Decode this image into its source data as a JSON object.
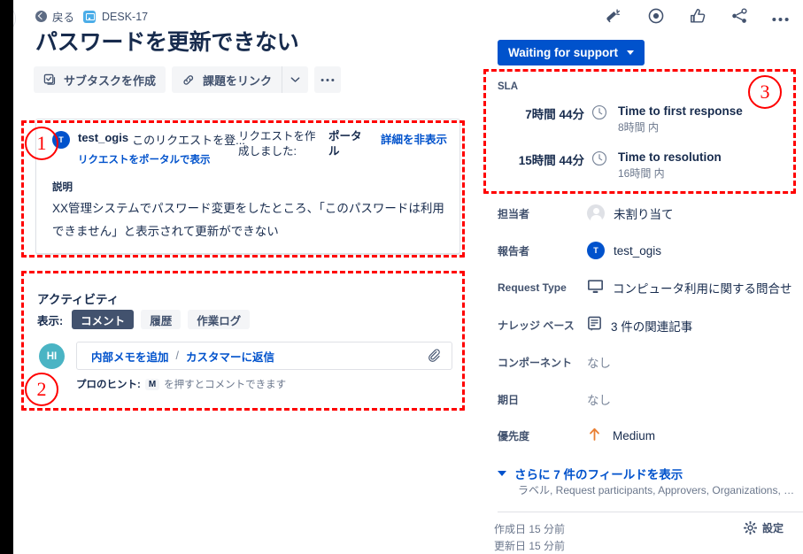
{
  "breadcrumb": {
    "back_label": "戻る",
    "issue_key": "DESK-17"
  },
  "page_title": "パスワードを更新できない",
  "toolbar": {
    "create_subtask": "サブタスクを作成",
    "link_issue": "課題をリンク",
    "more_label": "•••"
  },
  "top_icons": [
    "megaphone-icon",
    "watch-eye-icon",
    "thumbs-up-icon",
    "share-icon",
    "more-actions-icon"
  ],
  "request_card": {
    "avatar_initial": "T",
    "author": "test_ogis",
    "action_text": "このリクエストを登...",
    "meta_text": "リクエストを作成しました:",
    "channel": "ポータル",
    "hide_details": "詳細を非表示",
    "portal_link": "リクエストをポータルで表示",
    "description_label": "説明",
    "description_body": "XX管理システムでパスワード変更をしたところ、「このパスワードは利用できません」と表示されて更新ができない"
  },
  "activity": {
    "title": "アクティビティ",
    "filter_label": "表示:",
    "tabs": [
      {
        "label": "コメント",
        "active": true
      },
      {
        "label": "履歴",
        "active": false
      },
      {
        "label": "作業ログ",
        "active": false
      }
    ],
    "avatar_initials": "HI",
    "internal_note": "内部メモを追加",
    "separator": "/",
    "reply_customer": "カスタマーに返信",
    "attach_icon": "paperclip-icon",
    "hint_prefix": "プロのヒント:",
    "hint_key": "M",
    "hint_suffix": "を押すとコメントできます"
  },
  "status": {
    "label": "Waiting for support"
  },
  "sla": {
    "title": "SLA",
    "items": [
      {
        "time": "7時間 44分",
        "name": "Time to first response",
        "goal": "8時間 内"
      },
      {
        "time": "15時間 44分",
        "name": "Time to resolution",
        "goal": "16時間 内"
      }
    ]
  },
  "fields": [
    {
      "label": "担当者",
      "value": "未割り当て",
      "icon": "user-avatar-empty-icon",
      "muted": false
    },
    {
      "label": "報告者",
      "value": "test_ogis",
      "icon": "user-avatar-t-icon",
      "muted": false
    },
    {
      "label": "Request Type",
      "value": "コンピュータ利用に関する問合せ",
      "icon": "monitor-icon",
      "muted": false
    },
    {
      "label": "ナレッジ ベース",
      "value": "3 件の関連記事",
      "icon": "book-icon",
      "muted": false
    },
    {
      "label": "コンポーネント",
      "value": "なし",
      "icon": "none",
      "muted": true
    },
    {
      "label": "期日",
      "value": "なし",
      "icon": "none",
      "muted": true
    },
    {
      "label": "優先度",
      "value": "Medium",
      "icon": "priority-up-arrow-icon",
      "muted": false
    }
  ],
  "more_fields": {
    "label": "さらに 7 件のフィールドを表示",
    "sub": "ラベル, Request participants, Approvers, Organizations, 時..."
  },
  "footer": {
    "created": "作成日 15 分前",
    "updated": "更新日 15 分前",
    "settings": "設定"
  },
  "annotations": [
    {
      "number": "①",
      "glyph": "1"
    },
    {
      "number": "②",
      "glyph": "2"
    },
    {
      "number": "③",
      "glyph": "3"
    }
  ],
  "colors": {
    "brand_blue": "#0052CC",
    "text": "#172B4D",
    "subtle_text": "#6B778C",
    "annotation_red": "#FF0000",
    "avatar_blue": "#0052CC",
    "avatar_teal": "#4AB4C4",
    "priority_orange": "#E97F33"
  }
}
